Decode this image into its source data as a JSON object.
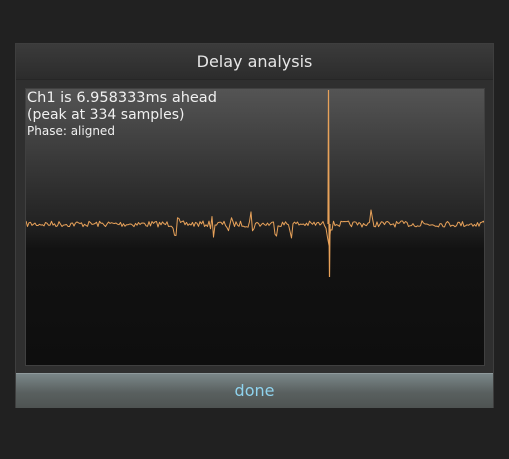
{
  "dialog": {
    "title": "Delay analysis",
    "result_line": "Ch1 is 6.958333ms ahead",
    "peak_line": "(peak at 334 samples)",
    "phase_line": "Phase: aligned",
    "done_label": "done"
  },
  "colors": {
    "waveform": "#e8a25a",
    "done_text": "#8fd3ee",
    "background": "#212121"
  }
}
